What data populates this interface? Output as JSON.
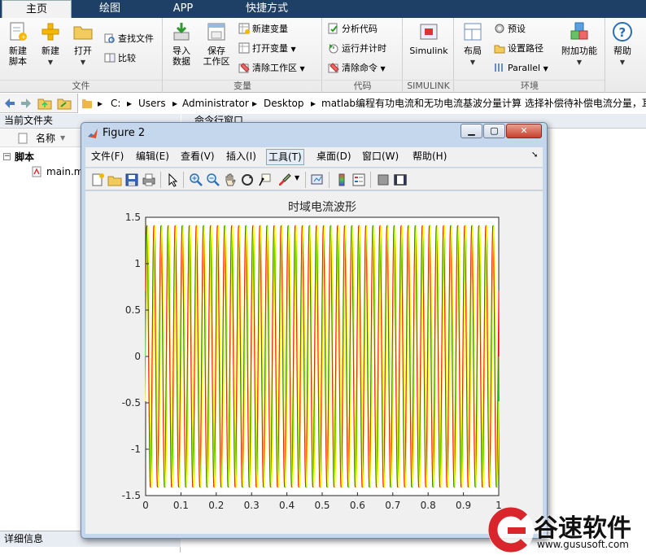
{
  "tabs": [
    {
      "label": "主页",
      "active": true
    },
    {
      "label": "绘图",
      "active": false
    },
    {
      "label": "APP",
      "active": false
    },
    {
      "label": "快捷方式",
      "active": false
    }
  ],
  "ribbon": {
    "groups": {
      "file": "文件",
      "variable": "变量",
      "code": "代码",
      "simulink": "SIMULINK",
      "env": "环境"
    },
    "new_script": "新建\n脚本",
    "new_script_l1": "新建",
    "new_script_l2": "脚本",
    "new": "新建",
    "open": "打开",
    "find_files": "查找文件",
    "compare": "比较",
    "import_l1": "导入",
    "import_l2": "数据",
    "save_ws_l1": "保存",
    "save_ws_l2": "工作区",
    "new_var": "新建变量",
    "open_var": "打开变量",
    "clear_ws": "清除工作区",
    "analyze_code": "分析代码",
    "run_time": "运行并计时",
    "clear_cmd": "清除命令",
    "simulink": "Simulink",
    "layout": "布局",
    "prefs": "预设",
    "set_path": "设置路径",
    "parallel": "Parallel",
    "addons": "附加功能",
    "help": "帮助"
  },
  "address": {
    "crumbs": [
      "C:",
      "Users",
      "Administrator",
      "Desktop",
      "matlab编程有功电流和无功电流基波分量计算 选择补偿待补偿电流分量，耳"
    ]
  },
  "left_panel": {
    "title": "当前文件夹",
    "col_name": "名称",
    "sort_arrow": "▼",
    "folder": "脚本",
    "file": "main.m",
    "details": "详细信息"
  },
  "command_window": {
    "title": "命令行窗口"
  },
  "figure": {
    "title": "Figure 2",
    "menus": [
      "文件(F)",
      "编辑(E)",
      "查看(V)",
      "插入(I)",
      "工具(T)",
      "桌面(D)",
      "窗口(W)",
      "帮助(H)"
    ],
    "active_menu": "工具(T)",
    "toolbar_icons": [
      "new-figure-icon",
      "open-file-icon",
      "save-icon",
      "print-icon",
      "select-arrow-icon",
      "zoom-in-icon",
      "zoom-out-icon",
      "pan-hand-icon",
      "rotate-3d-icon",
      "data-cursor-icon",
      "brush-icon",
      "brush-dropdown-icon",
      "link-plot-icon",
      "colorbar-icon",
      "legend-icon",
      "hide-plot-tools-icon",
      "show-plot-tools-icon"
    ]
  },
  "watermark": {
    "brand": "谷速软件",
    "url": "www.gususoft.com",
    "color": "#d9262c"
  },
  "chart_data": {
    "type": "line",
    "title": "时域电流波形",
    "xlabel": "",
    "ylabel": "",
    "xlim": [
      0,
      1
    ],
    "ylim": [
      -1.5,
      1.5
    ],
    "xticks": [
      "0",
      "0.1",
      "0.2",
      "0.3",
      "0.4",
      "0.5",
      "0.6",
      "0.7",
      "0.8",
      "0.9",
      "1"
    ],
    "yticks": [
      "1.5",
      "1",
      "0.5",
      "0",
      "-0.5",
      "-1",
      "-1.5"
    ],
    "series": [
      {
        "amplitude": 1.414,
        "frequency_hz": 50,
        "phase_deg": 30,
        "color": "#ff0000"
      },
      {
        "amplitude": 1.414,
        "frequency_hz": 50,
        "phase_deg": 0,
        "color": "#00cc00"
      },
      {
        "amplitude": 1.414,
        "frequency_hz": 50,
        "phase_deg": -20,
        "color": "#ffff00"
      }
    ]
  }
}
